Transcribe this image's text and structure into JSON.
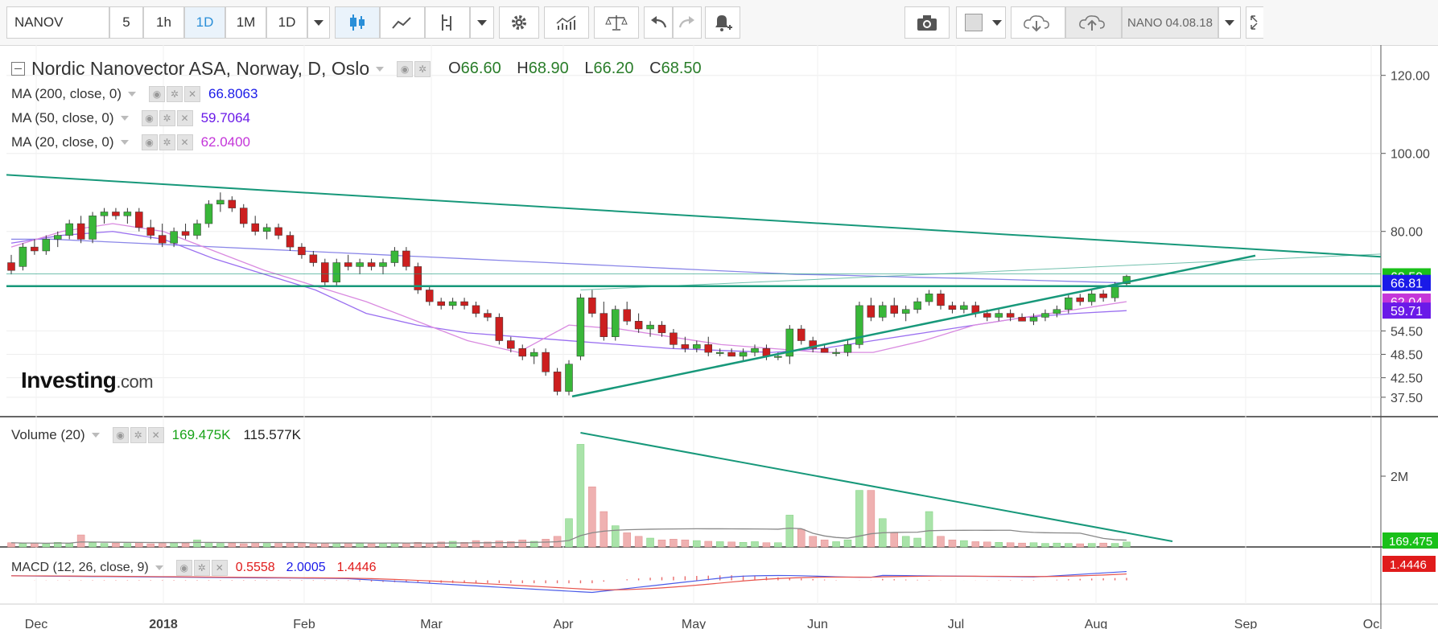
{
  "toolbar": {
    "symbol": "NANOV",
    "intervals": [
      "5",
      "1h",
      "1D",
      "1M",
      "1D"
    ],
    "active_interval_index": 2,
    "saved_label": "NANO 04.08.18",
    "icons": [
      "candles-icon",
      "line-chart-icon",
      "indicator-icon",
      "settings-gear-icon",
      "studies-icon",
      "compare-scale-icon",
      "undo-icon",
      "redo-icon",
      "alert-bell-icon",
      "camera-icon",
      "color-box-icon",
      "cloud-download-icon",
      "cloud-upload-icon",
      "fullscreen-icon"
    ]
  },
  "legend": {
    "title": "Nordic Nanovector ASA, Norway, D, Oslo",
    "open_label": "O",
    "open": "66.60",
    "high_label": "H",
    "high": "68.90",
    "low_label": "L",
    "low": "66.20",
    "close_label": "C",
    "close": "68.50",
    "ma200_label": "MA (200, close, 0)",
    "ma200_value": "66.8063",
    "ma50_label": "MA (50, close, 0)",
    "ma50_value": "59.7064",
    "ma20_label": "MA (20, close, 0)",
    "ma20_value": "62.0400",
    "volume_label": "Volume (20)",
    "volume_value": "169.475K",
    "volume_avg": "115.577K",
    "macd_label": "MACD (12, 26, close, 9)",
    "macd_hist": "0.5558",
    "macd_line": "2.0005",
    "macd_signal": "1.4446"
  },
  "logo": {
    "main": "Investing",
    "suffix": ".com"
  },
  "colors": {
    "up": "#19a319",
    "up_fill": "#39b739",
    "down": "#cc1f1f",
    "trend": "#17987a",
    "ma200": "#8a86e8",
    "ma50": "#9a6ff0",
    "ma20": "#d98ae0",
    "badge_close": "#19c019",
    "badge_ma200": "#1a1ae8",
    "badge_ma20": "#c436d9",
    "badge_ma50": "#6a1ae8",
    "badge_volume": "#19c019",
    "badge_macd": "#e01b1b"
  },
  "chart_data": {
    "type": "candlestick",
    "x_labels": [
      "Dec",
      "2018",
      "Feb",
      "Mar",
      "Apr",
      "May",
      "Jun",
      "Jul",
      "Aug",
      "Sep",
      "Oc"
    ],
    "price_ticks": [
      "120.00",
      "100.00",
      "80.00",
      "68.50",
      "66.81",
      "62.04",
      "59.71",
      "54.50",
      "48.50",
      "42.50",
      "37.50"
    ],
    "price_axis_plain_ticks": [
      120,
      100,
      80,
      54.5,
      48.5,
      42.5,
      37.5
    ],
    "volume_ticks": [
      "2M"
    ],
    "volume_badge": "169.475",
    "macd_badge": "1.4446",
    "price_badges": [
      {
        "label": "68.50",
        "value": 68.5,
        "color_key": "badge_close"
      },
      {
        "label": "66.81",
        "value": 66.81,
        "color_key": "badge_ma200"
      },
      {
        "label": "62.04",
        "value": 62.04,
        "color_key": "badge_ma20"
      },
      {
        "label": "59.71",
        "value": 59.71,
        "color_key": "badge_ma50"
      }
    ],
    "candles": [
      {
        "x": 0,
        "o": 72,
        "h": 74,
        "l": 69,
        "c": 70
      },
      {
        "x": 1,
        "o": 71,
        "h": 77,
        "l": 70,
        "c": 76
      },
      {
        "x": 2,
        "o": 76,
        "h": 78,
        "l": 74,
        "c": 75
      },
      {
        "x": 3,
        "o": 75,
        "h": 79,
        "l": 74,
        "c": 78
      },
      {
        "x": 4,
        "o": 78,
        "h": 80,
        "l": 76,
        "c": 79
      },
      {
        "x": 5,
        "o": 79,
        "h": 83,
        "l": 78,
        "c": 82
      },
      {
        "x": 6,
        "o": 82,
        "h": 84,
        "l": 77,
        "c": 78
      },
      {
        "x": 7,
        "o": 78,
        "h": 85,
        "l": 77,
        "c": 84
      },
      {
        "x": 8,
        "o": 84,
        "h": 86,
        "l": 82,
        "c": 85
      },
      {
        "x": 9,
        "o": 85,
        "h": 86,
        "l": 83,
        "c": 84
      },
      {
        "x": 10,
        "o": 84,
        "h": 86,
        "l": 82,
        "c": 85
      },
      {
        "x": 11,
        "o": 85,
        "h": 86,
        "l": 80,
        "c": 81
      },
      {
        "x": 12,
        "o": 81,
        "h": 83,
        "l": 78,
        "c": 79
      },
      {
        "x": 13,
        "o": 79,
        "h": 82,
        "l": 76,
        "c": 77
      },
      {
        "x": 14,
        "o": 77,
        "h": 81,
        "l": 76,
        "c": 80
      },
      {
        "x": 15,
        "o": 80,
        "h": 82,
        "l": 78,
        "c": 79
      },
      {
        "x": 16,
        "o": 79,
        "h": 83,
        "l": 78,
        "c": 82
      },
      {
        "x": 17,
        "o": 82,
        "h": 88,
        "l": 81,
        "c": 87
      },
      {
        "x": 18,
        "o": 87,
        "h": 90,
        "l": 85,
        "c": 88
      },
      {
        "x": 19,
        "o": 88,
        "h": 89,
        "l": 85,
        "c": 86
      },
      {
        "x": 20,
        "o": 86,
        "h": 87,
        "l": 81,
        "c": 82
      },
      {
        "x": 21,
        "o": 82,
        "h": 84,
        "l": 79,
        "c": 80
      },
      {
        "x": 22,
        "o": 80,
        "h": 82,
        "l": 78,
        "c": 81
      },
      {
        "x": 23,
        "o": 81,
        "h": 82,
        "l": 78,
        "c": 79
      },
      {
        "x": 24,
        "o": 79,
        "h": 80,
        "l": 75,
        "c": 76
      },
      {
        "x": 25,
        "o": 76,
        "h": 77,
        "l": 73,
        "c": 74
      },
      {
        "x": 26,
        "o": 74,
        "h": 75,
        "l": 71,
        "c": 72
      },
      {
        "x": 27,
        "o": 72,
        "h": 73,
        "l": 66,
        "c": 67
      },
      {
        "x": 28,
        "o": 67,
        "h": 73,
        "l": 66,
        "c": 72
      },
      {
        "x": 29,
        "o": 72,
        "h": 74,
        "l": 70,
        "c": 71
      },
      {
        "x": 30,
        "o": 71,
        "h": 73,
        "l": 69,
        "c": 72
      },
      {
        "x": 31,
        "o": 72,
        "h": 73,
        "l": 70,
        "c": 71
      },
      {
        "x": 32,
        "o": 71,
        "h": 73,
        "l": 69,
        "c": 72
      },
      {
        "x": 33,
        "o": 72,
        "h": 76,
        "l": 71,
        "c": 75
      },
      {
        "x": 34,
        "o": 75,
        "h": 76,
        "l": 70,
        "c": 71
      },
      {
        "x": 35,
        "o": 71,
        "h": 72,
        "l": 64,
        "c": 65
      },
      {
        "x": 36,
        "o": 65,
        "h": 66,
        "l": 61,
        "c": 62
      },
      {
        "x": 37,
        "o": 62,
        "h": 63,
        "l": 60,
        "c": 61
      },
      {
        "x": 38,
        "o": 61,
        "h": 63,
        "l": 60,
        "c": 62
      },
      {
        "x": 39,
        "o": 62,
        "h": 63,
        "l": 60,
        "c": 61
      },
      {
        "x": 40,
        "o": 61,
        "h": 62,
        "l": 58,
        "c": 59
      },
      {
        "x": 41,
        "o": 59,
        "h": 60,
        "l": 57,
        "c": 58
      },
      {
        "x": 42,
        "o": 58,
        "h": 59,
        "l": 51,
        "c": 52
      },
      {
        "x": 43,
        "o": 52,
        "h": 53,
        "l": 49,
        "c": 50
      },
      {
        "x": 44,
        "o": 50,
        "h": 51,
        "l": 47,
        "c": 48
      },
      {
        "x": 45,
        "o": 48,
        "h": 50,
        "l": 46,
        "c": 49
      },
      {
        "x": 46,
        "o": 49,
        "h": 50,
        "l": 43,
        "c": 44
      },
      {
        "x": 47,
        "o": 44,
        "h": 45,
        "l": 38,
        "c": 39
      },
      {
        "x": 48,
        "o": 39,
        "h": 47,
        "l": 38,
        "c": 46
      },
      {
        "x": 49,
        "o": 48,
        "h": 64,
        "l": 47,
        "c": 63
      },
      {
        "x": 50,
        "o": 63,
        "h": 65,
        "l": 58,
        "c": 59
      },
      {
        "x": 51,
        "o": 59,
        "h": 62,
        "l": 52,
        "c": 53
      },
      {
        "x": 52,
        "o": 53,
        "h": 61,
        "l": 52,
        "c": 60
      },
      {
        "x": 53,
        "o": 60,
        "h": 62,
        "l": 56,
        "c": 57
      },
      {
        "x": 54,
        "o": 57,
        "h": 59,
        "l": 54,
        "c": 55
      },
      {
        "x": 55,
        "o": 55,
        "h": 57,
        "l": 53,
        "c": 56
      },
      {
        "x": 56,
        "o": 56,
        "h": 57,
        "l": 53,
        "c": 54
      },
      {
        "x": 57,
        "o": 54,
        "h": 55,
        "l": 50,
        "c": 51
      },
      {
        "x": 58,
        "o": 51,
        "h": 53,
        "l": 49,
        "c": 50
      },
      {
        "x": 59,
        "o": 50,
        "h": 52,
        "l": 49,
        "c": 51
      },
      {
        "x": 60,
        "o": 51,
        "h": 53,
        "l": 48,
        "c": 49
      },
      {
        "x": 61,
        "o": 49,
        "h": 50,
        "l": 48,
        "c": 49
      },
      {
        "x": 62,
        "o": 49,
        "h": 50,
        "l": 48,
        "c": 48
      },
      {
        "x": 63,
        "o": 48,
        "h": 50,
        "l": 47,
        "c": 49
      },
      {
        "x": 64,
        "o": 49,
        "h": 51,
        "l": 48,
        "c": 50
      },
      {
        "x": 65,
        "o": 50,
        "h": 51,
        "l": 47,
        "c": 48
      },
      {
        "x": 66,
        "o": 48,
        "h": 49,
        "l": 47,
        "c": 48
      },
      {
        "x": 67,
        "o": 48,
        "h": 56,
        "l": 46,
        "c": 55
      },
      {
        "x": 68,
        "o": 55,
        "h": 56,
        "l": 51,
        "c": 52
      },
      {
        "x": 69,
        "o": 52,
        "h": 53,
        "l": 49,
        "c": 50
      },
      {
        "x": 70,
        "o": 50,
        "h": 51,
        "l": 49,
        "c": 49
      },
      {
        "x": 71,
        "o": 49,
        "h": 50,
        "l": 48,
        "c": 49
      },
      {
        "x": 72,
        "o": 49,
        "h": 52,
        "l": 48,
        "c": 51
      },
      {
        "x": 73,
        "o": 51,
        "h": 62,
        "l": 50,
        "c": 61
      },
      {
        "x": 74,
        "o": 61,
        "h": 63,
        "l": 57,
        "c": 58
      },
      {
        "x": 75,
        "o": 58,
        "h": 62,
        "l": 57,
        "c": 61
      },
      {
        "x": 76,
        "o": 61,
        "h": 63,
        "l": 58,
        "c": 59
      },
      {
        "x": 77,
        "o": 59,
        "h": 61,
        "l": 57,
        "c": 60
      },
      {
        "x": 78,
        "o": 60,
        "h": 63,
        "l": 59,
        "c": 62
      },
      {
        "x": 79,
        "o": 62,
        "h": 65,
        "l": 61,
        "c": 64
      },
      {
        "x": 80,
        "o": 64,
        "h": 65,
        "l": 60,
        "c": 61
      },
      {
        "x": 81,
        "o": 61,
        "h": 62,
        "l": 59,
        "c": 60
      },
      {
        "x": 82,
        "o": 60,
        "h": 62,
        "l": 59,
        "c": 61
      },
      {
        "x": 83,
        "o": 61,
        "h": 62,
        "l": 58,
        "c": 59
      },
      {
        "x": 84,
        "o": 59,
        "h": 60,
        "l": 57,
        "c": 58
      },
      {
        "x": 85,
        "o": 58,
        "h": 60,
        "l": 57,
        "c": 59
      },
      {
        "x": 86,
        "o": 59,
        "h": 60,
        "l": 57,
        "c": 58
      },
      {
        "x": 87,
        "o": 58,
        "h": 59,
        "l": 57,
        "c": 57
      },
      {
        "x": 88,
        "o": 57,
        "h": 59,
        "l": 56,
        "c": 58
      },
      {
        "x": 89,
        "o": 58,
        "h": 60,
        "l": 57,
        "c": 59
      },
      {
        "x": 90,
        "o": 59,
        "h": 61,
        "l": 58,
        "c": 60
      },
      {
        "x": 91,
        "o": 60,
        "h": 64,
        "l": 59,
        "c": 63
      },
      {
        "x": 92,
        "o": 63,
        "h": 64,
        "l": 61,
        "c": 62
      },
      {
        "x": 93,
        "o": 62,
        "h": 65,
        "l": 61,
        "c": 64
      },
      {
        "x": 94,
        "o": 64,
        "h": 65,
        "l": 62,
        "c": 63
      },
      {
        "x": 95,
        "o": 63,
        "h": 67,
        "l": 62,
        "c": 66
      },
      {
        "x": 96,
        "o": 66.6,
        "h": 68.9,
        "l": 66.2,
        "c": 68.5
      }
    ],
    "ma200": [
      78,
      78,
      77.5,
      77,
      76.5,
      76,
      75.5,
      75,
      74.5,
      74,
      73.5,
      73,
      72.5,
      72,
      71.5,
      71,
      70.5,
      70,
      69.5,
      69,
      68.8,
      68.5,
      68.2,
      68,
      67.7,
      67.4,
      67.1,
      66.8
    ],
    "ma50": [
      77,
      79,
      80,
      78,
      73,
      69,
      65,
      59,
      56,
      54,
      53,
      52,
      51,
      50,
      49.5,
      49,
      50,
      52,
      54,
      56,
      58,
      59,
      59.7
    ],
    "ma20": [
      76,
      80,
      82,
      80,
      75,
      70,
      66,
      62,
      57,
      52,
      49,
      56,
      55,
      53,
      51,
      50,
      49,
      49,
      52,
      56,
      58,
      60,
      62
    ],
    "volumes": [
      0.12,
      0.1,
      0.11,
      0.09,
      0.13,
      0.1,
      0.34,
      0.12,
      0.1,
      0.11,
      0.1,
      0.12,
      0.09,
      0.1,
      0.13,
      0.11,
      0.2,
      0.12,
      0.1,
      0.11,
      0.09,
      0.13,
      0.1,
      0.1,
      0.12,
      0.11,
      0.09,
      0.1,
      0.12,
      0.1,
      0.1,
      0.09,
      0.11,
      0.12,
      0.1,
      0.13,
      0.12,
      0.14,
      0.16,
      0.13,
      0.18,
      0.14,
      0.17,
      0.15,
      0.2,
      0.16,
      0.22,
      0.3,
      0.8,
      2.9,
      1.7,
      1.0,
      0.6,
      0.4,
      0.3,
      0.25,
      0.2,
      0.22,
      0.2,
      0.18,
      0.16,
      0.15,
      0.14,
      0.13,
      0.15,
      0.12,
      0.12,
      0.9,
      0.5,
      0.3,
      0.2,
      0.15,
      0.2,
      1.6,
      1.6,
      0.8,
      0.4,
      0.3,
      0.25,
      1.0,
      0.3,
      0.2,
      0.18,
      0.15,
      0.14,
      0.13,
      0.12,
      0.11,
      0.12,
      0.1,
      0.11,
      0.1,
      0.09,
      0.1,
      0.11,
      0.1,
      0.14
    ],
    "volume_max": 3.0
  }
}
